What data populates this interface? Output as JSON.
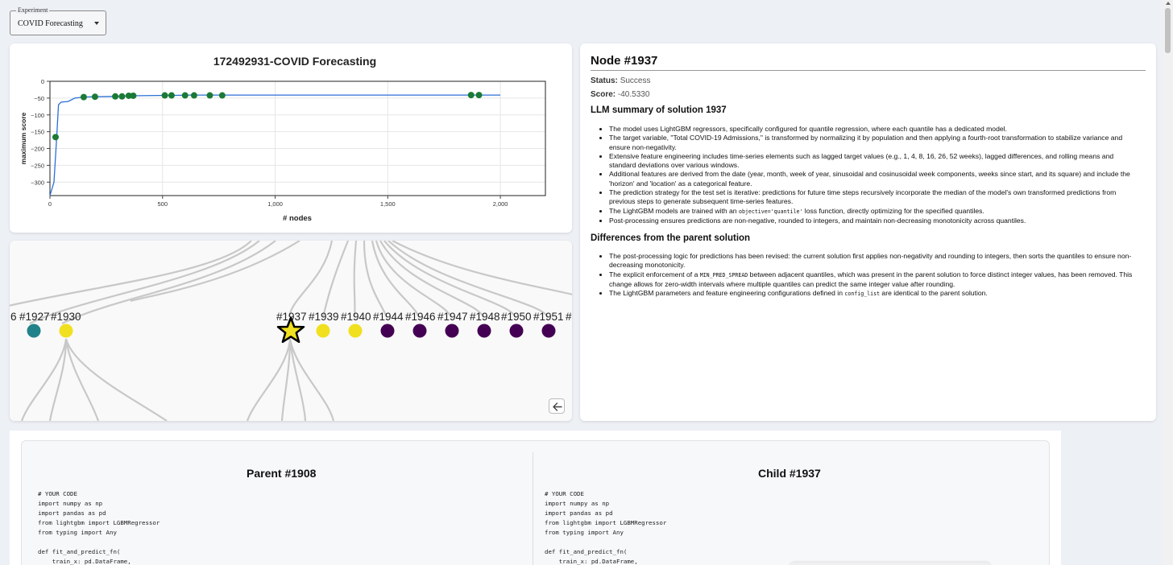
{
  "experiment": {
    "label": "Experiment",
    "value": "COVID Forecasting"
  },
  "chart_data": {
    "type": "scatter",
    "title": "172492931-COVID Forecasting",
    "xlabel": "# nodes",
    "ylabel": "maximum score",
    "xlim": [
      0,
      2200
    ],
    "ylim": [
      -340,
      0
    ],
    "xticks": [
      0,
      500,
      1000,
      1500,
      2000
    ],
    "xtick_labels": [
      "0",
      "500",
      "1,000",
      "1,500",
      "2,000"
    ],
    "yticks": [
      0,
      -50,
      -100,
      -150,
      -200,
      -250,
      -300
    ],
    "yticks_labels": [
      "0",
      "−50",
      "−100",
      "−150",
      "−200",
      "−250",
      "−300"
    ],
    "grid": true,
    "line_color": "#2b6fd6",
    "point_color": "#1a7a35",
    "line": {
      "x": [
        0,
        18,
        30,
        38,
        50,
        80,
        110,
        150,
        200,
        300,
        360,
        520,
        560,
        610,
        2000
      ],
      "y": [
        -340,
        -300,
        -165,
        -70,
        -62,
        -60,
        -50,
        -47,
        -46,
        -45,
        -43,
        -42,
        -42,
        -41,
        -41
      ]
    },
    "points": {
      "x": [
        25,
        150,
        200,
        290,
        320,
        350,
        370,
        510,
        540,
        600,
        640,
        710,
        765,
        1870,
        1905
      ],
      "y": [
        -166,
        -47,
        -46,
        -45,
        -45,
        -43,
        -43,
        -42,
        -42,
        -42,
        -42,
        -42,
        -42,
        -41,
        -41
      ]
    }
  },
  "tree": {
    "labels": [
      "6",
      "#1927",
      "#1930",
      "#1937",
      "#1939",
      "#1940",
      "#1944",
      "#1946",
      "#1947",
      "#1948",
      "#1950",
      "#1951",
      "#"
    ],
    "colors": {
      "teal": "#22828a",
      "yellow": "#f0e020",
      "purple": "#440154",
      "edge": "#c8c8c8"
    }
  },
  "node": {
    "title": "Node #1937",
    "status_label": "Status:",
    "status_value": "Success",
    "score_label": "Score:",
    "score_value": "-40.5330",
    "summary_heading": "LLM summary of solution 1937",
    "summary": [
      "The model uses LightGBM regressors, specifically configured for quantile regression, where each quantile has a dedicated model.",
      "The target variable, \"Total COVID-19 Admissions,\" is transformed by normalizing it by population and then applying a fourth-root transformation to stabilize variance and ensure non-negativity.",
      "Extensive feature engineering includes time-series elements such as lagged target values (e.g., 1, 4, 8, 16, 26, 52 weeks), lagged differences, and rolling means and standard deviations over various windows.",
      "Additional features are derived from the date (year, month, week of year, sinusoidal and cosinusoidal week components, weeks since start, and its square) and include the 'horizon' and 'location' as a categorical feature.",
      "The prediction strategy for the test set is iterative: predictions for future time steps recursively incorporate the median of the model's own transformed predictions from previous steps to generate subsequent time-series features."
    ],
    "summary_6a": "The LightGBM models are trained with an ",
    "summary_6b": "objective='quantile'",
    "summary_6c": " loss function, directly optimizing for the specified quantiles.",
    "summary_7": "Post-processing ensures predictions are non-negative, rounded to integers, and maintain non-decreasing monotonicity across quantiles.",
    "diff_heading": "Differences from the parent solution",
    "diff_1": "The post-processing logic for predictions has been revised: the current solution first applies non-negativity and rounding to integers, then sorts the quantiles to ensure non-decreasing monotonicity.",
    "diff_2a": "The explicit enforcement of a ",
    "diff_2b": "MIN_PRED_SPREAD",
    "diff_2c": " between adjacent quantiles, which was present in the parent solution to force distinct integer values, has been removed. This change allows for zero-width intervals where multiple quantiles can predict the same integer value after rounding.",
    "diff_3a": "The LightGBM parameters and feature engineering configurations defined in ",
    "diff_3b": "config_list",
    "diff_3c": " are identical to the parent solution."
  },
  "code": {
    "parent_title": "Parent #1908",
    "child_title": "Child #1937",
    "parent_code": "# YOUR CODE\nimport numpy as np\nimport pandas as pd\nfrom lightgbm import LGBMRegressor\nfrom typing import Any\n\ndef fit_and_predict_fn(\n    train_x: pd.DataFrame,",
    "child_code": "# YOUR CODE\nimport numpy as np\nimport pandas as pd\nfrom lightgbm import LGBMRegressor\nfrom typing import Any\n\ndef fit_and_predict_fn(\n    train_x: pd.DataFrame,"
  }
}
